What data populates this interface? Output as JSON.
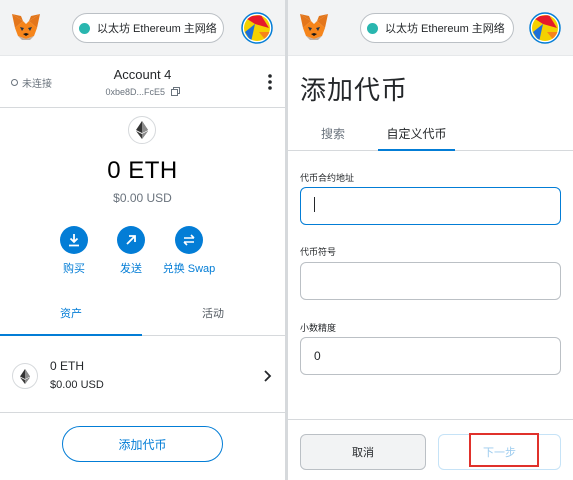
{
  "network": {
    "label": "以太坊 Ethereum 主网络"
  },
  "wallet": {
    "connection_status": "未连接",
    "account_name": "Account 4",
    "address": "0xbe8D...FcE5",
    "balance": "0 ETH",
    "balance_usd": "$0.00 USD",
    "actions": [
      {
        "label": "购买",
        "icon": "download-icon"
      },
      {
        "label": "发送",
        "icon": "arrow-up-right-icon"
      },
      {
        "label": "兑换 Swap",
        "icon": "swap-icon"
      }
    ],
    "tabs": [
      {
        "label": "资产",
        "active": true
      },
      {
        "label": "活动",
        "active": false
      }
    ],
    "assets": [
      {
        "amount": "0 ETH",
        "usd": "$0.00 USD"
      }
    ],
    "add_token_label": "添加代币"
  },
  "add_token_page": {
    "title": "添加代币",
    "tabs": [
      {
        "label": "搜索",
        "active": false
      },
      {
        "label": "自定义代币",
        "active": true
      }
    ],
    "fields": [
      {
        "label": "代币合约地址",
        "value": ""
      },
      {
        "label": "代币符号",
        "value": ""
      },
      {
        "label": "小数精度",
        "value": "0"
      }
    ],
    "cancel_label": "取消",
    "next_label": "下一步"
  },
  "colors": {
    "accent": "#037dd6",
    "network_dot": "#29b6af",
    "highlight": "#e0312b"
  }
}
